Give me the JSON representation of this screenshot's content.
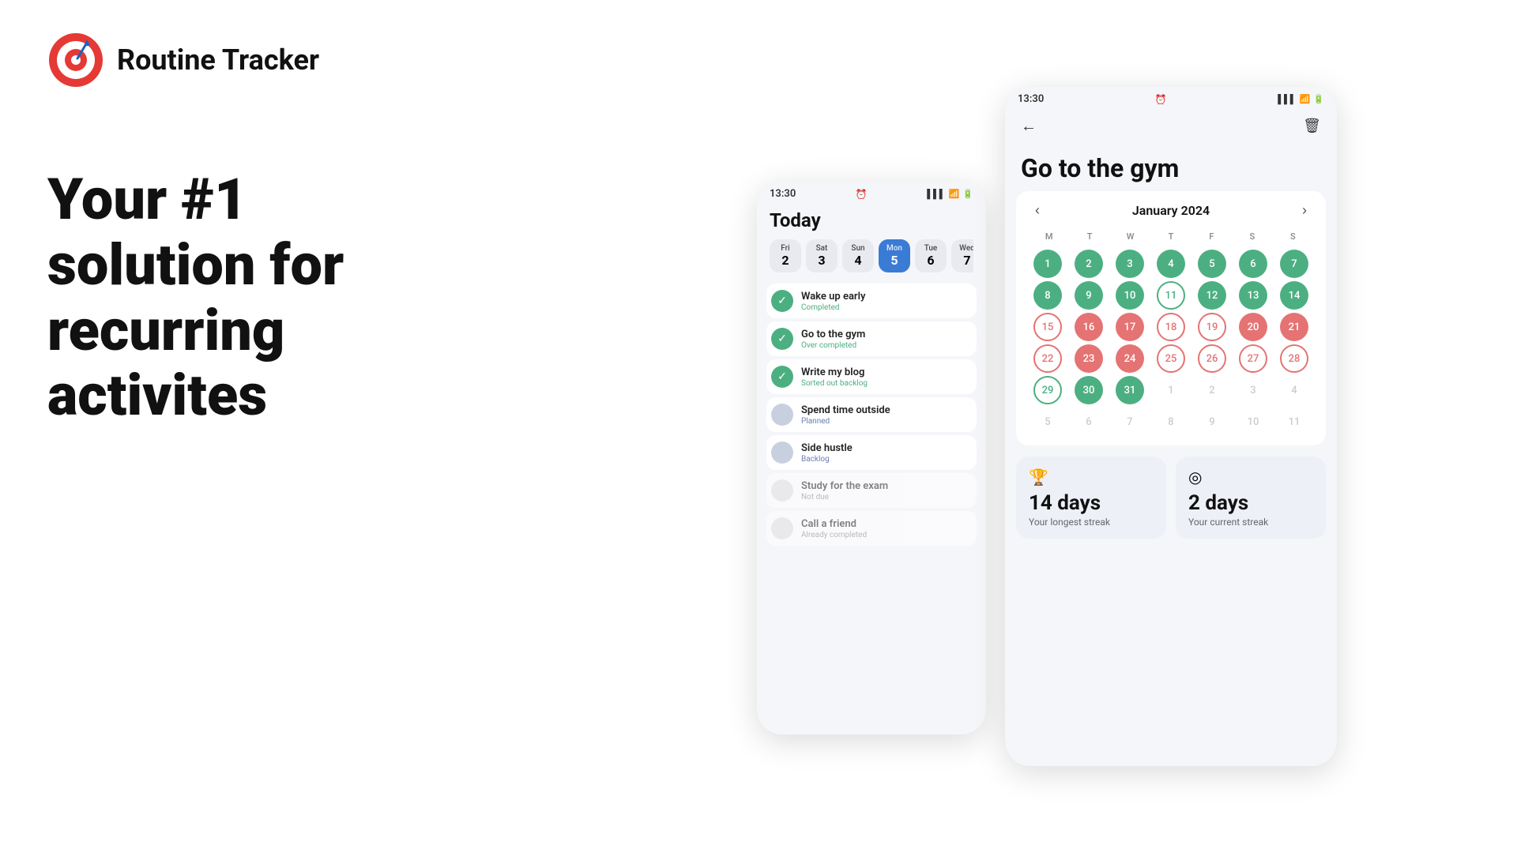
{
  "header": {
    "app_title": "Routine Tracker"
  },
  "hero": {
    "line1": "Your #1",
    "line2": "solution for",
    "line3": "recurring",
    "line4": "activites"
  },
  "phone1": {
    "status_time": "13:30",
    "screen_title": "Today",
    "dates": [
      {
        "day": "Fri",
        "num": "2",
        "active": false
      },
      {
        "day": "Sat",
        "num": "3",
        "active": false
      },
      {
        "day": "Sun",
        "num": "4",
        "active": false
      },
      {
        "day": "Mon",
        "num": "5",
        "active": true
      },
      {
        "day": "Tue",
        "num": "6",
        "active": false
      },
      {
        "day": "Wed",
        "num": "7",
        "active": false
      }
    ],
    "tasks": [
      {
        "name": "Wake up early",
        "status": "Completed",
        "type": "completed"
      },
      {
        "name": "Go to the gym",
        "status": "Over completed",
        "type": "over-completed"
      },
      {
        "name": "Write my blog",
        "status": "Sorted out backlog",
        "type": "sorted"
      },
      {
        "name": "Spend time outside",
        "status": "Planned",
        "type": "planned"
      },
      {
        "name": "Side hustle",
        "status": "Backlog",
        "type": "backlog"
      },
      {
        "name": "Study for the exam",
        "status": "Not due",
        "type": "not-due"
      },
      {
        "name": "Call a friend",
        "status": "Already completed",
        "type": "already"
      }
    ]
  },
  "phone2": {
    "status_time": "13:30",
    "screen_title": "Go to the gym",
    "calendar": {
      "month": "January 2024",
      "weekdays": [
        "M",
        "T",
        "W",
        "T",
        "F",
        "S",
        "S"
      ],
      "weeks": [
        [
          {
            "num": "1",
            "type": "green-filled"
          },
          {
            "num": "2",
            "type": "green-filled"
          },
          {
            "num": "3",
            "type": "green-filled"
          },
          {
            "num": "4",
            "type": "green-filled"
          },
          {
            "num": "5",
            "type": "green-filled"
          },
          {
            "num": "6",
            "type": "green-filled"
          },
          {
            "num": "7",
            "type": "green-filled"
          }
        ],
        [
          {
            "num": "8",
            "type": "green-filled"
          },
          {
            "num": "9",
            "type": "green-filled"
          },
          {
            "num": "10",
            "type": "green-filled"
          },
          {
            "num": "11",
            "type": "green-ring"
          },
          {
            "num": "12",
            "type": "green-filled"
          },
          {
            "num": "13",
            "type": "green-filled"
          },
          {
            "num": "14",
            "type": "green-filled"
          }
        ],
        [
          {
            "num": "15",
            "type": "pink-ring"
          },
          {
            "num": "16",
            "type": "pink-filled"
          },
          {
            "num": "17",
            "type": "pink-filled"
          },
          {
            "num": "18",
            "type": "pink-ring"
          },
          {
            "num": "19",
            "type": "pink-ring"
          },
          {
            "num": "20",
            "type": "pink-filled"
          },
          {
            "num": "21",
            "type": "pink-filled"
          }
        ],
        [
          {
            "num": "22",
            "type": "pink-ring"
          },
          {
            "num": "23",
            "type": "pink-filled"
          },
          {
            "num": "24",
            "type": "pink-filled"
          },
          {
            "num": "25",
            "type": "pink-ring"
          },
          {
            "num": "26",
            "type": "pink-ring"
          },
          {
            "num": "27",
            "type": "pink-ring"
          },
          {
            "num": "28",
            "type": "pink-ring"
          }
        ],
        [
          {
            "num": "29",
            "type": "green-ring"
          },
          {
            "num": "30",
            "type": "green-filled"
          },
          {
            "num": "31",
            "type": "green-filled"
          },
          {
            "num": "1",
            "type": "gray"
          },
          {
            "num": "2",
            "type": "gray"
          },
          {
            "num": "3",
            "type": "gray"
          },
          {
            "num": "4",
            "type": "gray"
          }
        ],
        [
          {
            "num": "5",
            "type": "gray"
          },
          {
            "num": "6",
            "type": "gray"
          },
          {
            "num": "7",
            "type": "gray"
          },
          {
            "num": "8",
            "type": "gray"
          },
          {
            "num": "9",
            "type": "gray"
          },
          {
            "num": "10",
            "type": "gray"
          },
          {
            "num": "11",
            "type": "gray"
          }
        ]
      ]
    },
    "streaks": [
      {
        "icon": "🏆",
        "days": "14 days",
        "label": "Your longest streak"
      },
      {
        "icon": "◎",
        "days": "2 days",
        "label": "Your current streak"
      }
    ]
  }
}
